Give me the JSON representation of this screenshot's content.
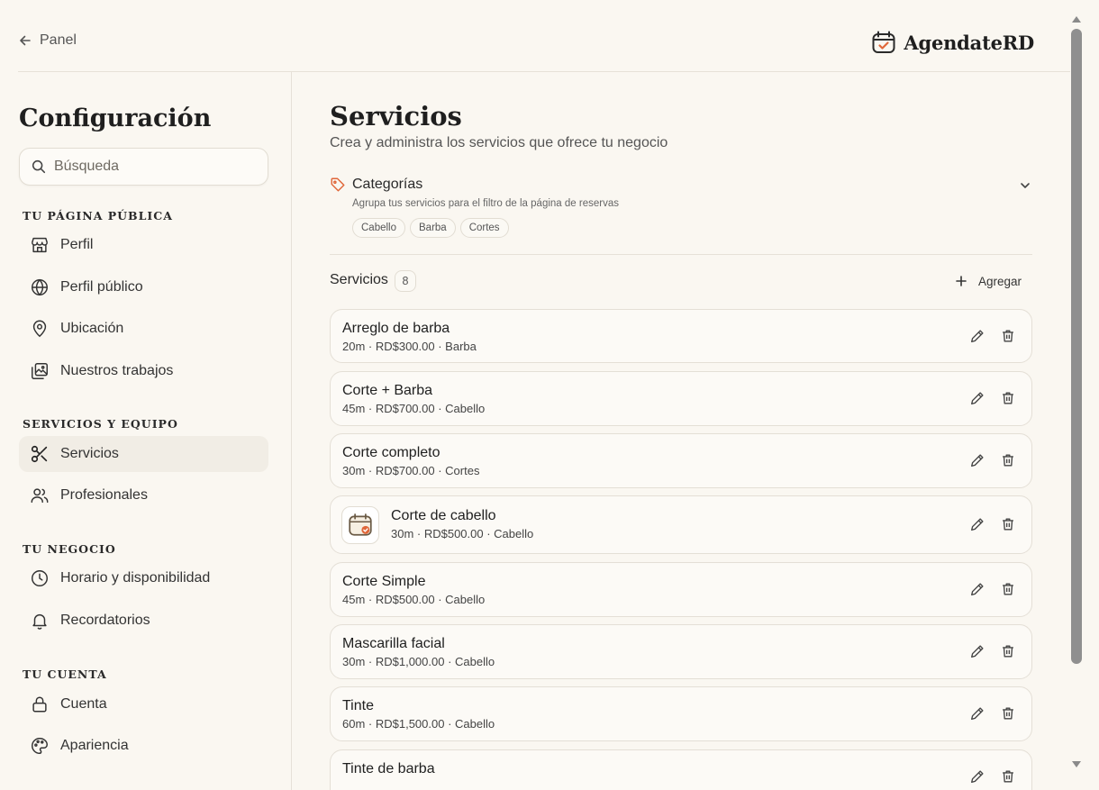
{
  "header": {
    "back_label": "Panel",
    "brand_name": "AgendateRD"
  },
  "sidebar": {
    "title": "Configuración",
    "search_placeholder": "Búsqueda",
    "sections": {
      "public_page": "TU PÁGINA PÚBLICA",
      "services_team": "SERVICIOS Y EQUIPO",
      "business": "TU NEGOCIO",
      "account": "TU CUENTA"
    },
    "items": {
      "perfil": "Perfil",
      "perfil_publico": "Perfil público",
      "ubicacion": "Ubicación",
      "trabajos": "Nuestros trabajos",
      "servicios": "Servicios",
      "profesionales": "Profesionales",
      "horario": "Horario y disponibilidad",
      "recordatorios": "Recordatorios",
      "cuenta": "Cuenta",
      "apariencia": "Apariencia"
    },
    "active_item": "servicios"
  },
  "main": {
    "title": "Servicios",
    "subtitle": "Crea y administra los servicios que ofrece tu negocio",
    "categories": {
      "title": "Categorías",
      "description": "Agrupa tus servicios para el filtro de la página de reservas",
      "chips": [
        "Cabello",
        "Barba",
        "Cortes"
      ]
    },
    "services_label": "Servicios",
    "services_count": "8",
    "add_label": "Agregar",
    "services": [
      {
        "name": "Arreglo de barba",
        "meta": "20m · RD$300.00 · Barba"
      },
      {
        "name": "Corte + Barba",
        "meta": "45m · RD$700.00 · Cabello"
      },
      {
        "name": "Corte completo",
        "meta": "30m · RD$700.00 · Cortes"
      },
      {
        "name": "Corte de cabello",
        "meta": "30m · RD$500.00 · Cabello"
      },
      {
        "name": "Corte Simple",
        "meta": "45m · RD$500.00 · Cabello"
      },
      {
        "name": "Mascarilla facial",
        "meta": "30m · RD$1,000.00 · Cabello"
      },
      {
        "name": "Tinte",
        "meta": "60m · RD$1,500.00 · Cabello"
      },
      {
        "name": "Tinte de barba",
        "meta": ""
      }
    ]
  },
  "colors": {
    "background": "#faf7f1",
    "accent": "#e0673a",
    "border": "#e4dfd6"
  }
}
